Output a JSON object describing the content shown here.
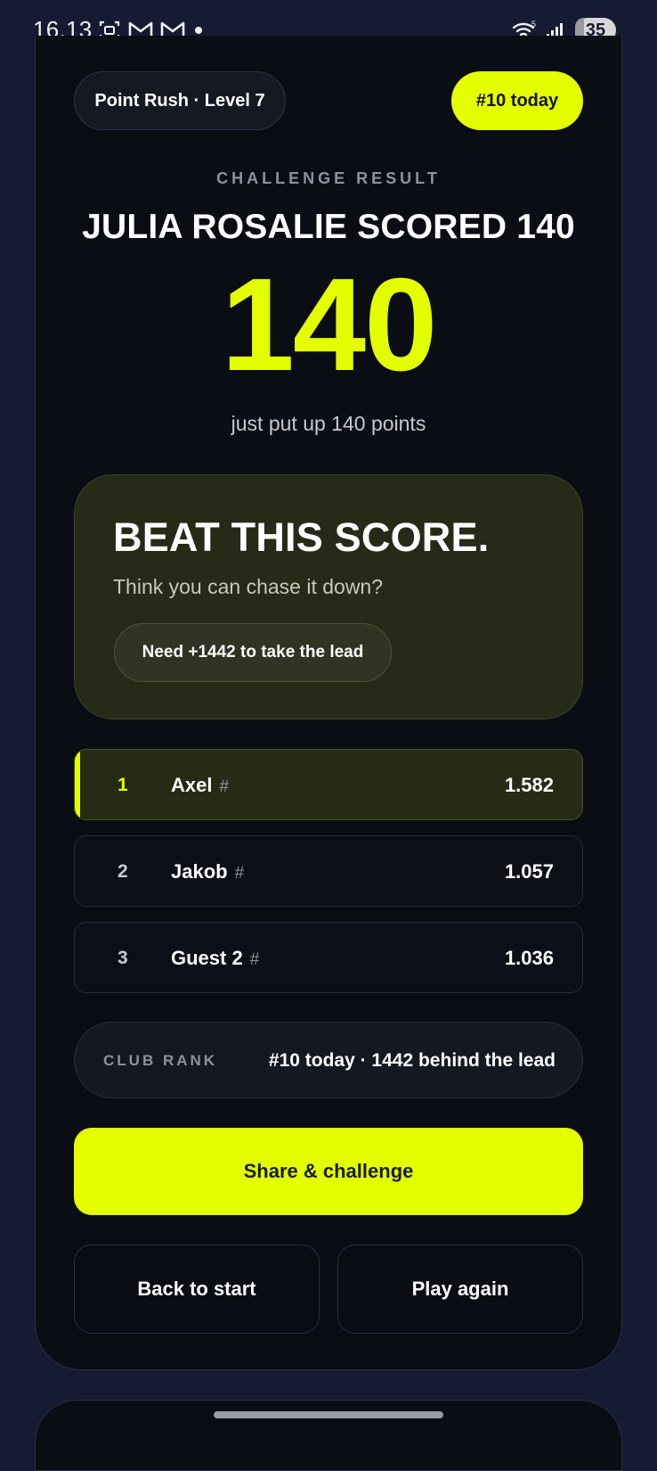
{
  "status_bar": {
    "time": "16.13",
    "left_icons": [
      "screenshot-icon",
      "gmail-icon",
      "gmail-icon",
      "dot-icon"
    ],
    "right_icons": [
      "wifi-icon",
      "signal-icon"
    ],
    "battery": "35"
  },
  "header": {
    "level_chip": "Point Rush · Level 7",
    "rank_chip": "#10 today"
  },
  "result": {
    "eyebrow": "CHALLENGE RESULT",
    "headline": "JULIA ROSALIE SCORED 140",
    "score": "140",
    "subline": "just put up 140 points"
  },
  "beat": {
    "title": "BEAT THIS SCORE.",
    "subtitle": "Think you can chase it down?",
    "need_label": "Need +1442 to take the lead"
  },
  "leaderboard": [
    {
      "pos": "1",
      "name": "Axel",
      "hash": "#",
      "score": "1.582",
      "lead": true
    },
    {
      "pos": "2",
      "name": "Jakob",
      "hash": "#",
      "score": "1.057",
      "lead": false
    },
    {
      "pos": "3",
      "name": "Guest 2",
      "hash": "#",
      "score": "1.036",
      "lead": false
    }
  ],
  "club_rank": {
    "label": "CLUB RANK",
    "value": "#10 today · 1442 behind the lead"
  },
  "actions": {
    "share": "Share & challenge",
    "back": "Back to start",
    "again": "Play again"
  },
  "colors": {
    "accent": "#e4ff00",
    "background": "#161a33",
    "card": "#0a0d14"
  }
}
